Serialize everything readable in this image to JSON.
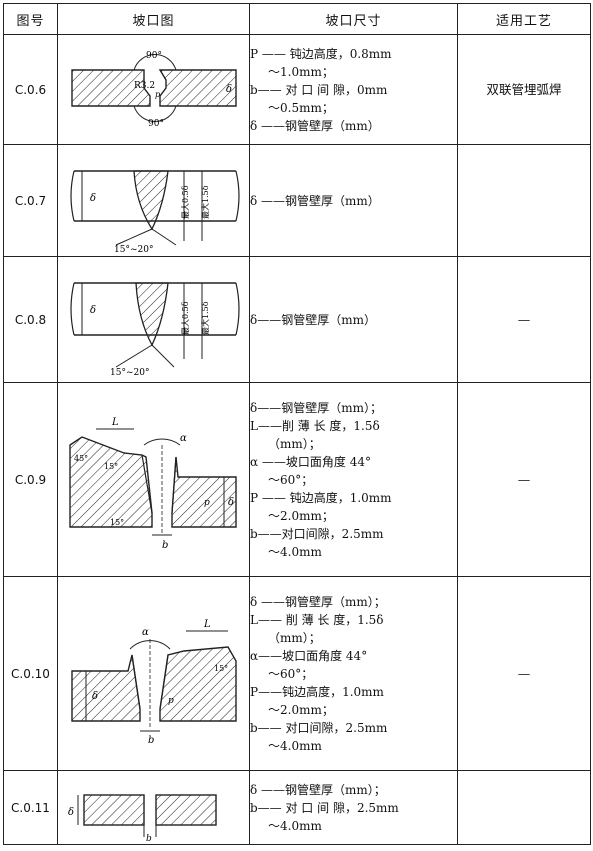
{
  "headers": {
    "id": "图号",
    "figure": "坡口图",
    "dimensions": "坡口尺寸",
    "process": "适用工艺"
  },
  "rows": [
    {
      "id": "C.0.6",
      "lines": [
        "P —— 钝边高度，0.8mm",
        "～1.0mm；",
        "b—— 对 口 间 隙，0mm",
        "～0.5mm；",
        "δ ——钢管壁厚（mm）"
      ],
      "process": "双联管埋弧焊",
      "figure_labels": [
        "90°",
        "R3.2",
        "p",
        "δ",
        "90°"
      ]
    },
    {
      "id": "C.0.7",
      "lines": [
        "δ ——钢管壁厚（mm）"
      ],
      "process": "",
      "figure_labels": [
        "δ",
        "最大0.5δ",
        "最大1.5δ",
        "15°~20°"
      ]
    },
    {
      "id": "C.0.8",
      "lines": [
        "δ——钢管壁厚（mm）"
      ],
      "process": "—",
      "figure_labels": [
        "δ",
        "最大0.5δ",
        "最大1.5δ",
        "15°~20°"
      ]
    },
    {
      "id": "C.0.9",
      "lines": [
        "δ——钢管壁厚（mm）；",
        "L——削 薄 长 度，1.5δ",
        "（mm）；",
        "α ——坡口面角度 44°",
        "～60°；",
        "P —— 钝边高度，1.0mm",
        "～2.0mm；",
        "b——对口间隙，2.5mm",
        "～4.0mm"
      ],
      "process": "—",
      "figure_labels": [
        "L",
        "45°",
        "15°",
        "α",
        "δ",
        "p",
        "15°",
        "b"
      ]
    },
    {
      "id": "C.0.10",
      "lines": [
        "δ ——钢管壁厚（mm）；",
        "L—— 削 薄 长 度，1.5δ",
        "（mm）；",
        "α——坡口面角度 44°",
        "～60°；",
        "P——钝边高度，1.0mm",
        "～2.0mm；",
        "b—— 对口间隙，2.5mm",
        "～4.0mm"
      ],
      "process": "—",
      "figure_labels": [
        "α",
        "L",
        "δ",
        "15°",
        "p",
        "b"
      ]
    },
    {
      "id": "C.0.11",
      "lines": [
        "δ ——钢管壁厚（mm）；",
        "b—— 对 口 间 隙，2.5mm",
        "～4.0mm"
      ],
      "process": "",
      "figure_labels": [
        "δ",
        "b"
      ]
    }
  ]
}
